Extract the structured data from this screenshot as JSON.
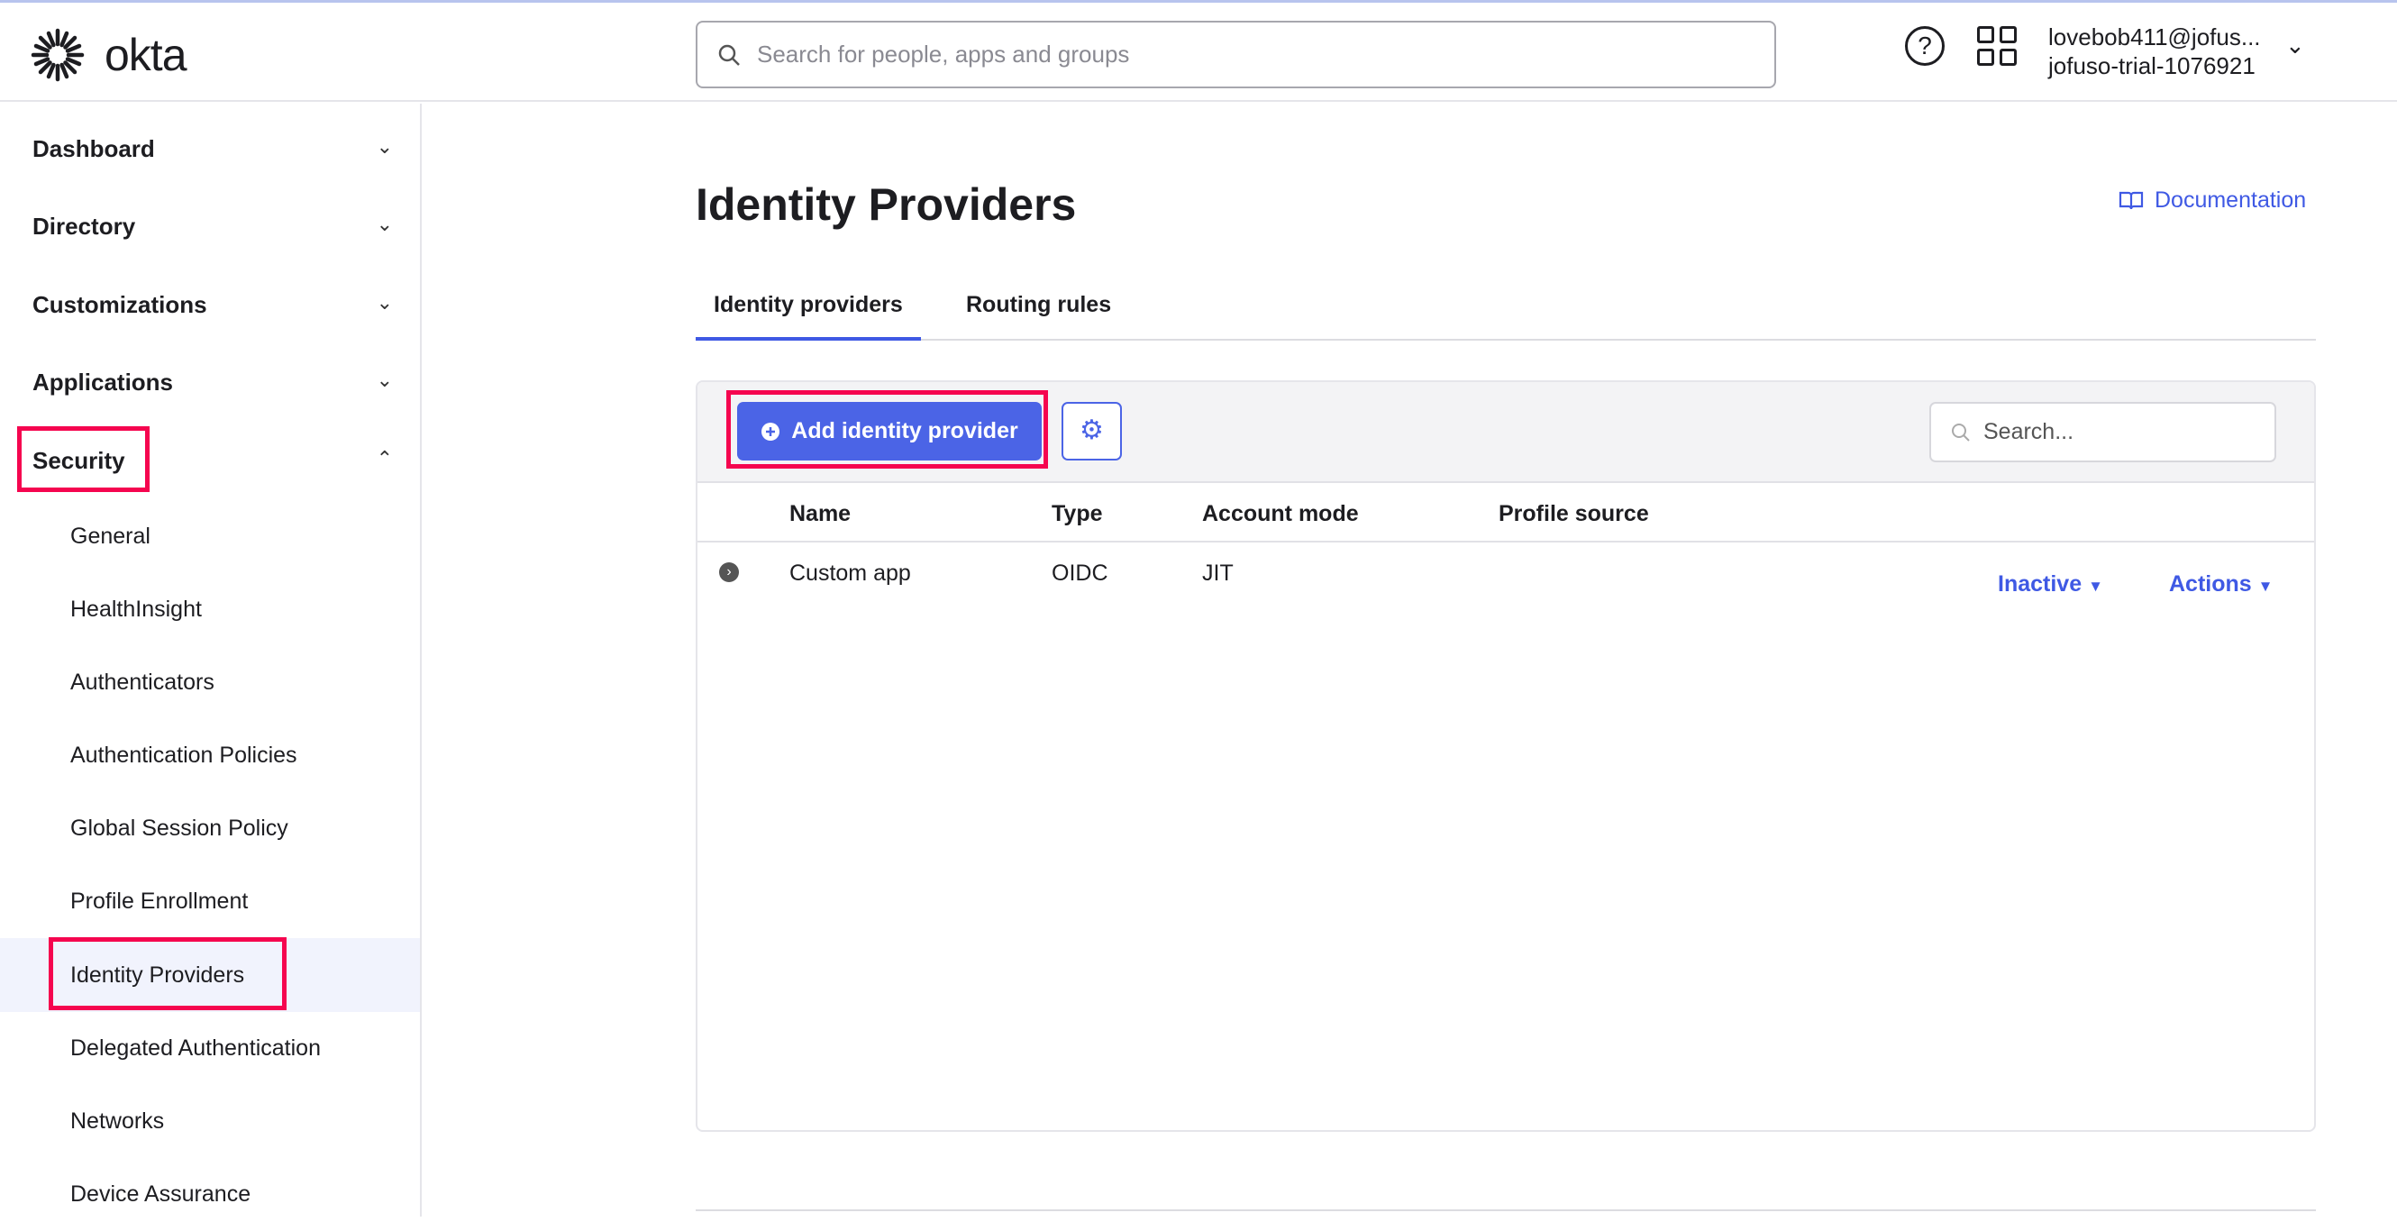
{
  "header": {
    "logo": "okta",
    "search_placeholder": "Search for people, apps and groups",
    "user_email": "lovebob411@jofus...",
    "user_org": "jofuso-trial-1076921"
  },
  "sidebar": {
    "top_items": [
      {
        "label": "Dashboard"
      },
      {
        "label": "Directory"
      },
      {
        "label": "Customizations"
      },
      {
        "label": "Applications"
      },
      {
        "label": "Security"
      }
    ],
    "security_items": [
      {
        "label": "General"
      },
      {
        "label": "HealthInsight"
      },
      {
        "label": "Authenticators"
      },
      {
        "label": "Authentication Policies"
      },
      {
        "label": "Global Session Policy"
      },
      {
        "label": "Profile Enrollment"
      },
      {
        "label": "Identity Providers"
      },
      {
        "label": "Delegated Authentication"
      },
      {
        "label": "Networks"
      },
      {
        "label": "Device Assurance"
      }
    ]
  },
  "main": {
    "title": "Identity Providers",
    "documentation": "Documentation",
    "tabs": [
      {
        "label": "Identity providers"
      },
      {
        "label": "Routing rules"
      }
    ],
    "add_button": "Add identity provider",
    "search_placeholder": "Search...",
    "columns": [
      "Name",
      "Type",
      "Account mode",
      "Profile source"
    ],
    "rows": [
      {
        "name": "Custom app",
        "type": "OIDC",
        "account_mode": "JIT",
        "profile_source": "",
        "status": "Inactive",
        "actions": "Actions"
      }
    ]
  },
  "colors": {
    "accent": "#4b64e6",
    "highlight": "#f5054f"
  }
}
